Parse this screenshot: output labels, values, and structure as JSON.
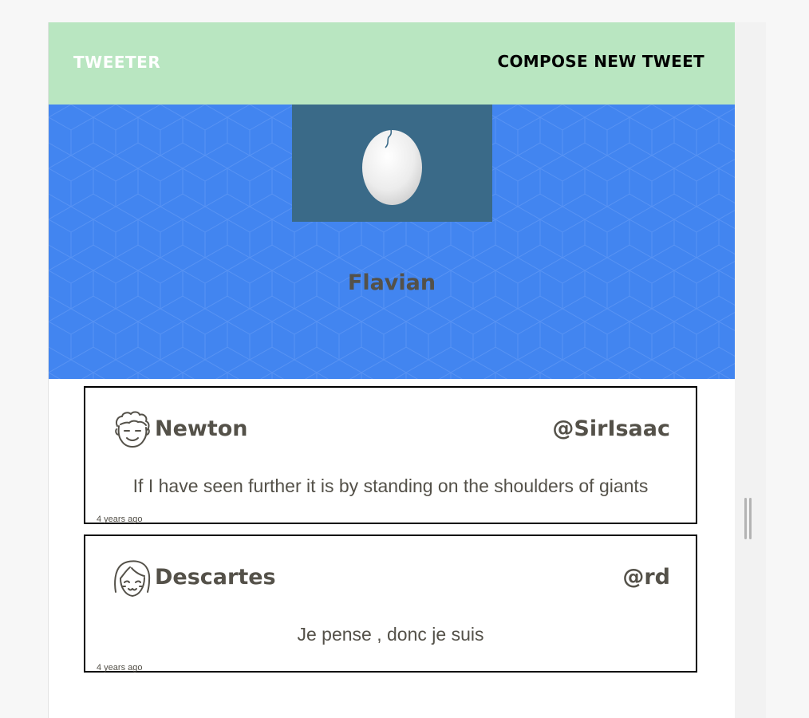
{
  "nav": {
    "brand": "TWEETER",
    "compose_label": "COMPOSE NEW TWEET"
  },
  "profile": {
    "name": "Flavian",
    "avatar_icon": "egg-icon",
    "banner_color": "#4285f0",
    "avatar_bg": "#3a6a88"
  },
  "tweets": [
    {
      "name": "Newton",
      "handle": "@SirIsaac",
      "content": "If I have seen further it is by standing on the shoulders of giants",
      "time": "4 years ago",
      "avatar_icon": "curly-hair-face-icon"
    },
    {
      "name": "Descartes",
      "handle": "@rd",
      "content": "Je pense , donc je suis",
      "time": "4 years ago",
      "avatar_icon": "bob-hair-face-icon"
    }
  ],
  "colors": {
    "nav_bg": "#b9e6c1",
    "text": "#545149",
    "border": "#000000"
  }
}
